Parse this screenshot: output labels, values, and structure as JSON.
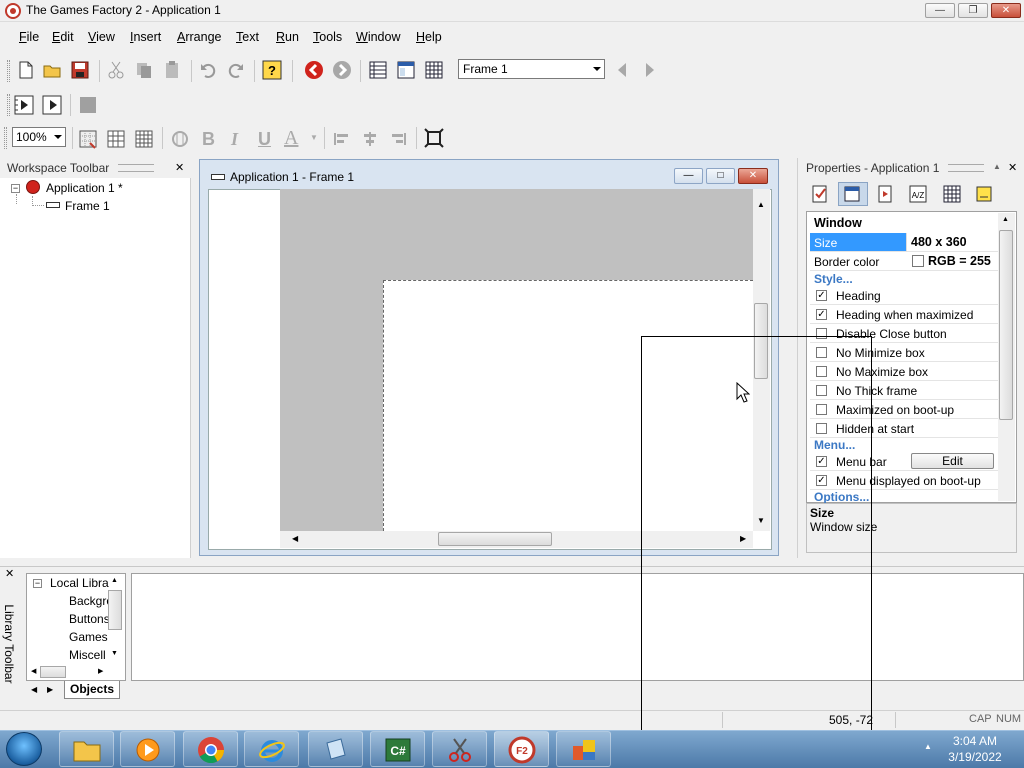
{
  "window": {
    "title": "The Games Factory 2 - Application 1"
  },
  "menu": {
    "items": [
      "File",
      "Edit",
      "View",
      "Insert",
      "Arrange",
      "Text",
      "Run",
      "Tools",
      "Window",
      "Help"
    ]
  },
  "toolbar": {
    "frame_select": "Frame 1",
    "zoom": "100%"
  },
  "workspace": {
    "title": "Workspace Toolbar",
    "app_node": "Application 1 *",
    "frame_node": "Frame 1"
  },
  "frame_window": {
    "title": "Application 1 - Frame 1"
  },
  "properties": {
    "title": "Properties - Application 1",
    "section": "Window",
    "rows": [
      {
        "label": "Size",
        "value": "480 x 360"
      },
      {
        "label": "Border color",
        "value": "RGB = 255"
      }
    ],
    "style_header": "Style...",
    "checks": [
      {
        "label": "Heading",
        "checked": true
      },
      {
        "label": "Heading when maximized",
        "checked": true
      },
      {
        "label": "Disable Close button",
        "checked": false
      },
      {
        "label": "No Minimize box",
        "checked": false
      },
      {
        "label": "No Maximize box",
        "checked": false
      },
      {
        "label": "No Thick frame",
        "checked": false
      },
      {
        "label": "Maximized on boot-up",
        "checked": false
      },
      {
        "label": "Hidden at start",
        "checked": false
      }
    ],
    "menu_header": "Menu...",
    "menu_checks": [
      {
        "label": "Menu bar",
        "checked": true
      },
      {
        "label": "Menu displayed on boot-up",
        "checked": true
      }
    ],
    "edit_button": "Edit",
    "options_header": "Options...",
    "help_title": "Size",
    "help_text": "Window size"
  },
  "library": {
    "side_label": "Library Toolbar",
    "root": "Local Libra",
    "items": [
      "Backgro",
      "Buttons",
      "Games",
      "Miscell"
    ],
    "tab": "Objects"
  },
  "status": {
    "coords": "505, -72",
    "cap": "CAP",
    "num": "NUM"
  },
  "taskbar": {
    "time": "3:04 AM",
    "date": "3/19/2022"
  },
  "colors": {
    "selection": "#3399ff",
    "accent_red": "#c0392b"
  }
}
